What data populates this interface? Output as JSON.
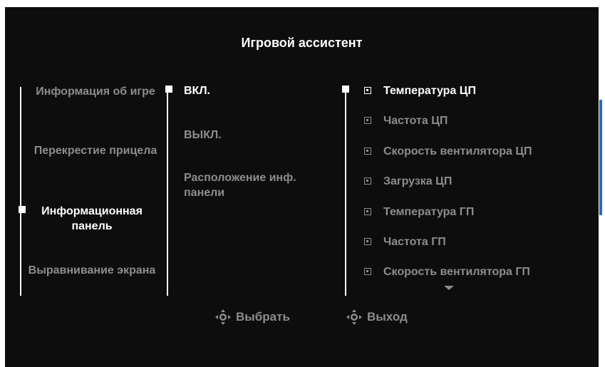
{
  "title": "Игровой ассистент",
  "menu": [
    {
      "label": "Информация об игре",
      "active": false
    },
    {
      "label": "Перекрестие прицела",
      "active": false
    },
    {
      "label": "Информационная панель",
      "active": true
    },
    {
      "label": "Выравнивание экрана",
      "active": false
    }
  ],
  "options": [
    {
      "label": "ВКЛ.",
      "active": true
    },
    {
      "label": "ВЫКЛ.",
      "active": false
    },
    {
      "label": "Расположение инф. панели",
      "active": false
    }
  ],
  "checks": [
    {
      "label": "Температура ЦП",
      "active": true
    },
    {
      "label": "Частота ЦП",
      "active": false
    },
    {
      "label": "Скорость вентилятора ЦП",
      "active": false
    },
    {
      "label": "Загрузка ЦП",
      "active": false
    },
    {
      "label": "Температура ГП",
      "active": false
    },
    {
      "label": "Частота ГП",
      "active": false
    },
    {
      "label": "Скорость вентилятора ГП",
      "active": false
    }
  ],
  "footer": {
    "select_label": "Выбрать",
    "exit_label": "Выход"
  },
  "colors": {
    "accent_scrollbar": "#1e6fd0",
    "inactive_text": "#8c8c8c",
    "active_text": "#ffffff",
    "background": "#0d0d0d"
  },
  "icons": {
    "joystick": "joystick-icon",
    "check": "checkbox-icon",
    "more": "chevron-down-icon"
  }
}
